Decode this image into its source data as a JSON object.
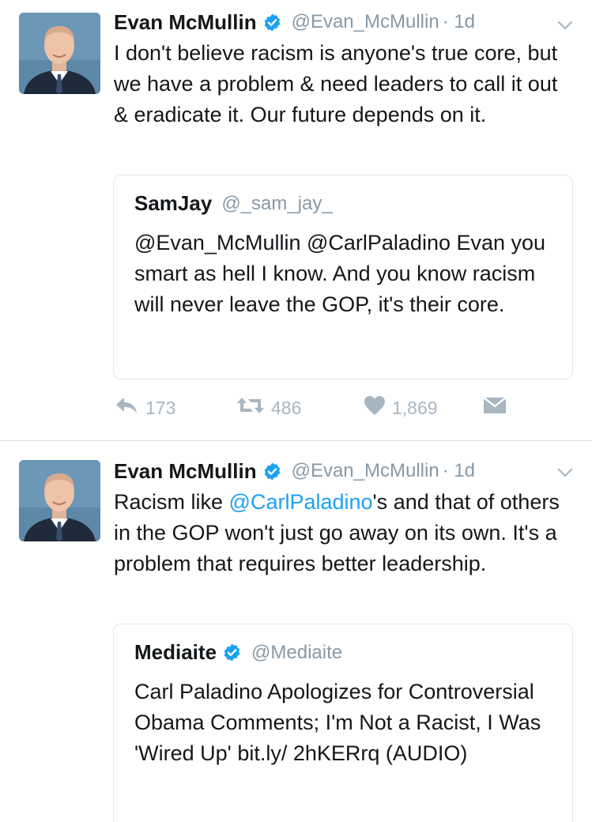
{
  "tweets": [
    {
      "author_name": "Evan McMullin",
      "handle": "@Evan_McMullin",
      "time": "· 1d",
      "text": "I don't believe racism is anyone's true core, but we have a problem & need leaders to call it out & eradicate it. Our future depends on it.",
      "quote": {
        "author_name": "SamJay",
        "handle": "@_sam_jay_",
        "text": "@Evan_McMullin @CarlPaladino Evan you smart as hell I know.  And you know racism will never leave the GOP, it's their core."
      },
      "actions": {
        "replies": "173",
        "retweets": "486",
        "likes": "1,869"
      }
    },
    {
      "author_name": "Evan McMullin",
      "handle": "@Evan_McMullin",
      "time": "· 1d",
      "text_before": "Racism like ",
      "text_mention": "@CarlPaladino",
      "text_after": "'s and that of others in the GOP won't just go away on its own. It's a problem that requires better leadership.",
      "quote": {
        "author_name": "Mediaite",
        "handle": "@Mediaite",
        "text": "Carl Paladino Apologizes for Controversial Obama Comments; I'm Not a Racist, I Was 'Wired Up' bit.ly/ 2hKERrq (AUDIO)"
      }
    }
  ],
  "icons": {
    "verified": "verified-badge-icon",
    "chevron": "chevron-down-icon",
    "reply": "reply-icon",
    "retweet": "retweet-icon",
    "like": "heart-icon",
    "dm": "envelope-icon"
  },
  "colors": {
    "text": "#14171a",
    "secondary": "#8899a6",
    "link": "#1da1f2",
    "action": "#a8b6c2",
    "verified": "#1da1f2",
    "border": "#e1e8ed"
  }
}
